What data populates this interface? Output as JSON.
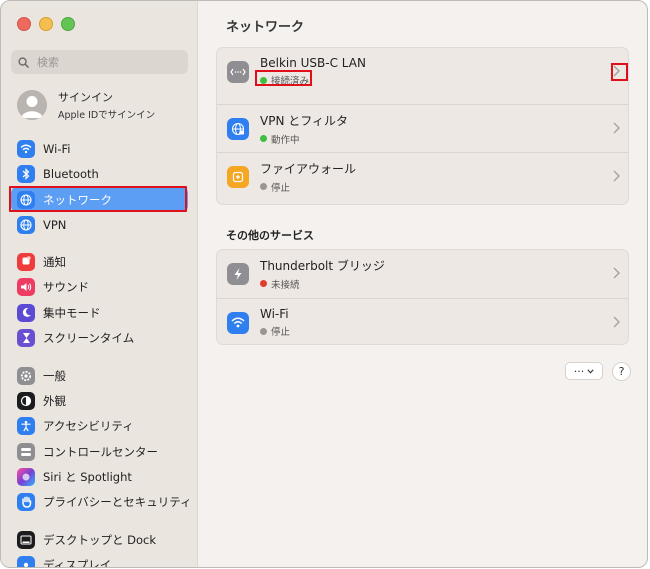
{
  "sidebar": {
    "search_placeholder": "検索",
    "account": {
      "name": "サインイン",
      "subtitle": "Apple IDでサインイン"
    },
    "items": [
      {
        "label": "Wi-Fi",
        "icon": "wifi-icon",
        "color": "#2f7ff0"
      },
      {
        "label": "Bluetooth",
        "icon": "bluetooth-icon",
        "color": "#2f7ff0"
      },
      {
        "label": "ネットワーク",
        "icon": "globe-icon",
        "color": "#2f7ff0",
        "selected": true
      },
      {
        "label": "VPN",
        "icon": "vpn-globe-icon",
        "color": "#2f7ff0"
      },
      {
        "label": "通知",
        "icon": "bell-icon",
        "color": "#ee3b3b"
      },
      {
        "label": "サウンド",
        "icon": "speaker-icon",
        "color": "#ee3b63"
      },
      {
        "label": "集中モード",
        "icon": "moon-icon",
        "color": "#5b4bd4"
      },
      {
        "label": "スクリーンタイム",
        "icon": "hourglass-icon",
        "color": "#6a4fd1"
      },
      {
        "label": "一般",
        "icon": "gear-icon",
        "color": "#8e8e93"
      },
      {
        "label": "外観",
        "icon": "appearance-icon",
        "color": "#1c1c1e"
      },
      {
        "label": "アクセシビリティ",
        "icon": "accessibility-icon",
        "color": "#2f7ff0"
      },
      {
        "label": "コントロールセンター",
        "icon": "control-center-icon",
        "color": "#8e8e93"
      },
      {
        "label": "Siri と Spotlight",
        "icon": "siri-icon",
        "color": "#7a3fd0"
      },
      {
        "label": "プライバシーとセキュリティ",
        "icon": "hand-icon",
        "color": "#2f7ff0"
      },
      {
        "label": "デスクトップと Dock",
        "icon": "dock-icon",
        "color": "#1c1c1e"
      },
      {
        "label": "ディスプレイ",
        "icon": "display-icon",
        "color": "#2f7ff0"
      }
    ]
  },
  "main": {
    "title": "ネットワーク",
    "primary_services": [
      {
        "name": "Belkin USB-C LAN",
        "status": "接続済み",
        "status_color": "#3fbf3f",
        "icon": "ethernet-icon"
      },
      {
        "name": "VPN とフィルタ",
        "status": "動作中",
        "status_color": "#3fbf3f",
        "icon": "vpn-globe-icon"
      },
      {
        "name": "ファイアウォール",
        "status": "停止",
        "status_color": "#9a9591",
        "icon": "firewall-icon"
      }
    ],
    "other_title": "その他のサービス",
    "other_services": [
      {
        "name": "Thunderbolt ブリッジ",
        "status": "未接続",
        "status_color": "#e23b2f",
        "icon": "thunderbolt-icon"
      },
      {
        "name": "Wi-Fi",
        "status": "停止",
        "status_color": "#9a9591",
        "icon": "wifi-icon"
      }
    ],
    "more_label": "···",
    "help_label": "?"
  }
}
